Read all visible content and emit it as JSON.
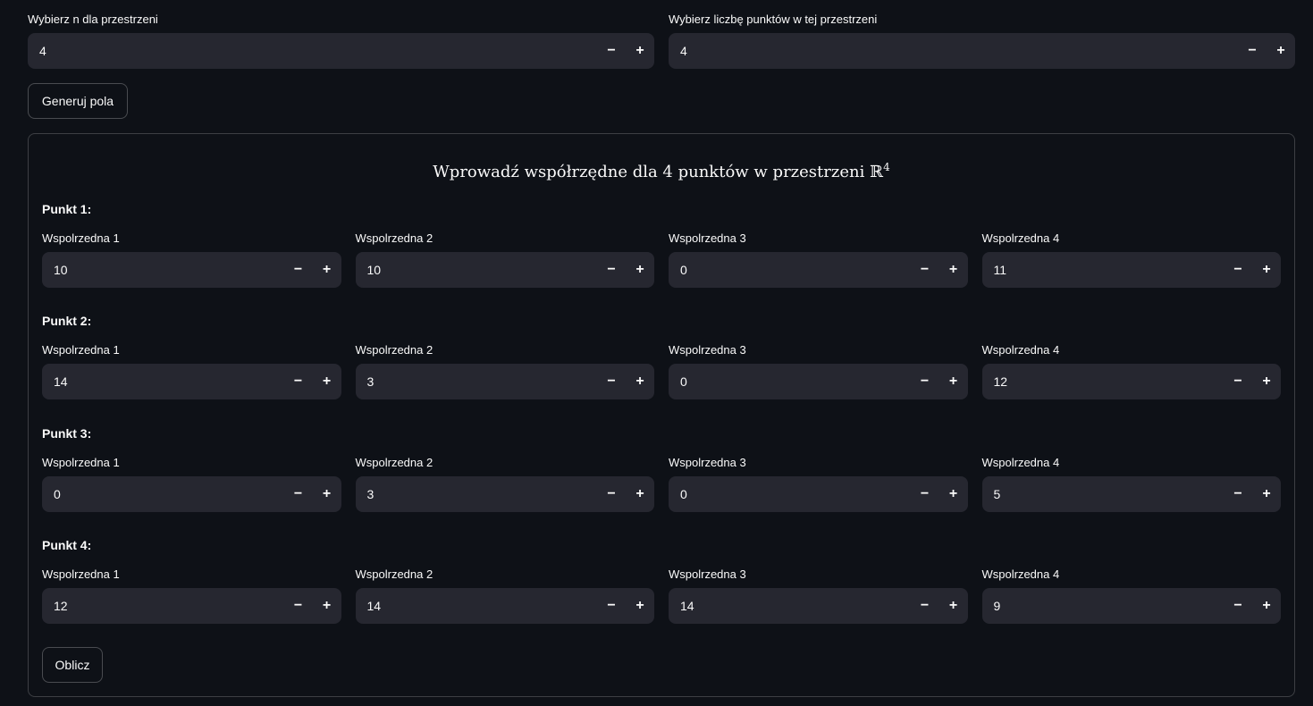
{
  "top": {
    "n_label": "Wybierz n dla przestrzeni",
    "n_value": "4",
    "points_label": "Wybierz liczbę punktów w tej przestrzeni",
    "points_value": "4",
    "minus": "−",
    "plus": "+"
  },
  "generate_button": "Generuj pola",
  "panel": {
    "title": "Wprowadź współrzędne dla 4 punktów w przestrzeni ℝ",
    "title_sup": "4"
  },
  "points": [
    {
      "heading": "Punkt 1:",
      "coords": [
        {
          "label": "Wspolrzedna 1",
          "value": "10"
        },
        {
          "label": "Wspolrzedna 2",
          "value": "10"
        },
        {
          "label": "Wspolrzedna 3",
          "value": "0"
        },
        {
          "label": "Wspolrzedna 4",
          "value": "11"
        }
      ]
    },
    {
      "heading": "Punkt 2:",
      "coords": [
        {
          "label": "Wspolrzedna 1",
          "value": "14"
        },
        {
          "label": "Wspolrzedna 2",
          "value": "3"
        },
        {
          "label": "Wspolrzedna 3",
          "value": "0"
        },
        {
          "label": "Wspolrzedna 4",
          "value": "12"
        }
      ]
    },
    {
      "heading": "Punkt 3:",
      "coords": [
        {
          "label": "Wspolrzedna 1",
          "value": "0"
        },
        {
          "label": "Wspolrzedna 2",
          "value": "3"
        },
        {
          "label": "Wspolrzedna 3",
          "value": "0"
        },
        {
          "label": "Wspolrzedna 4",
          "value": "5"
        }
      ]
    },
    {
      "heading": "Punkt 4:",
      "coords": [
        {
          "label": "Wspolrzedna 1",
          "value": "12"
        },
        {
          "label": "Wspolrzedna 2",
          "value": "14"
        },
        {
          "label": "Wspolrzedna 3",
          "value": "14"
        },
        {
          "label": "Wspolrzedna 4",
          "value": "9"
        }
      ]
    }
  ],
  "calculate_button": "Oblicz",
  "colors": {
    "background": "#0e1117",
    "input_background": "#262730",
    "text": "#fafafa"
  }
}
